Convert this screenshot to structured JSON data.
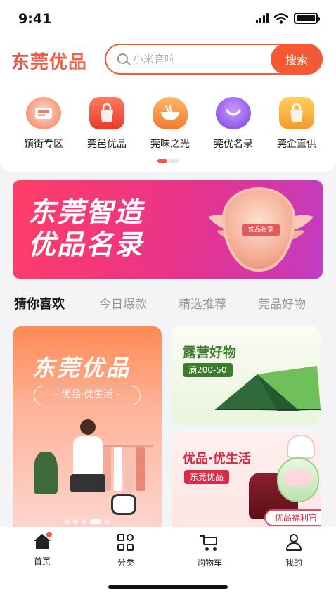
{
  "status_bar": {
    "time": "9:41"
  },
  "header": {
    "logo": "东莞优品",
    "search": {
      "placeholder": "小米音响",
      "button": "搜索"
    }
  },
  "categories": [
    {
      "label": "镇街专区",
      "icon": "town-district-icon",
      "color": "#f27a5a"
    },
    {
      "label": "莞邑优品",
      "icon": "shopping-bag-icon",
      "color": "#f0563c"
    },
    {
      "label": "莞味之光",
      "icon": "noodle-bowl-icon",
      "color": "#f58a3c"
    },
    {
      "label": "莞优名录",
      "icon": "smile-badge-icon",
      "color": "#8b54e6"
    },
    {
      "label": "莞企直供",
      "icon": "enterprise-bag-icon",
      "color": "#f59a2e"
    }
  ],
  "banner": {
    "title_line1": "东莞智造",
    "title_line2": "优品名录",
    "badge": "优品名录"
  },
  "tabs": [
    {
      "label": "猜你喜欢",
      "active": true
    },
    {
      "label": "今日爆款",
      "active": false
    },
    {
      "label": "精选推荐",
      "active": false
    },
    {
      "label": "莞品好物",
      "active": false
    }
  ],
  "cards": {
    "left": {
      "title": "东莞优品",
      "subtitle": "- 优品·优生活 -"
    },
    "right_top": {
      "title": "露营好物",
      "tag": "满200-50"
    },
    "right_bottom": {
      "title": "优品·优生活",
      "tag": "东莞优品",
      "badge": "优品福利官"
    }
  },
  "tabbar": [
    {
      "label": "首页",
      "icon": "home-icon"
    },
    {
      "label": "分类",
      "icon": "category-grid-icon"
    },
    {
      "label": "购物车",
      "icon": "cart-icon"
    },
    {
      "label": "我的",
      "icon": "user-icon"
    }
  ]
}
